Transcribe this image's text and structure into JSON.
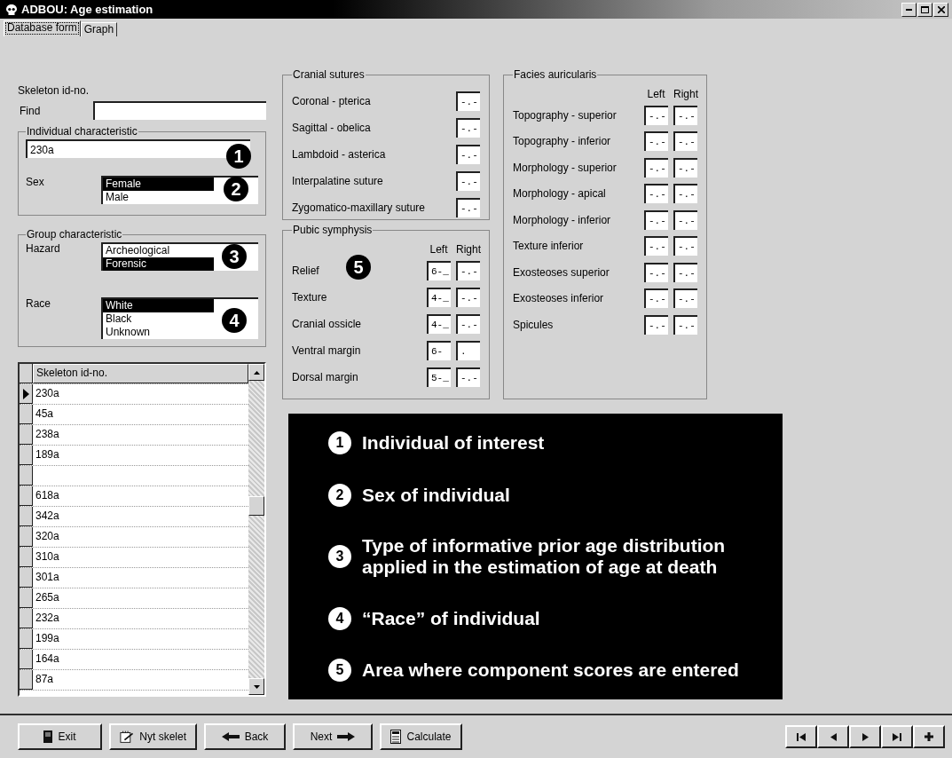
{
  "window": {
    "title": "ADBOU: Age estimation"
  },
  "tabs": [
    {
      "label": "Database form",
      "selected": true
    },
    {
      "label": "Graph",
      "selected": false
    }
  ],
  "skeleton_label": "Skeleton id-no.",
  "find": {
    "label": "Find"
  },
  "individual": {
    "title": "Individual characteristic",
    "id_value": "230a",
    "sex": {
      "label": "Sex",
      "options": [
        {
          "label": "Female",
          "selected": true
        },
        {
          "label": "Male",
          "selected": false
        }
      ]
    }
  },
  "group": {
    "title": "Group characteristic",
    "hazard": {
      "label": "Hazard",
      "options": [
        {
          "label": "Archeological",
          "selected": false
        },
        {
          "label": "Forensic",
          "selected": true
        }
      ]
    },
    "race": {
      "label": "Race",
      "options": [
        {
          "label": "White",
          "selected": true
        },
        {
          "label": "Black",
          "selected": false
        },
        {
          "label": "Unknown",
          "selected": false
        }
      ]
    }
  },
  "table": {
    "column": "Skeleton id-no.",
    "rows": [
      {
        "id": "230a",
        "selected": true
      },
      {
        "id": "45a",
        "selected": false
      },
      {
        "id": "238a",
        "selected": false
      },
      {
        "id": "189a",
        "selected": false
      },
      {
        "selected": false
      },
      {
        "id": "618a",
        "selected": false
      },
      {
        "id": "342a",
        "selected": false
      },
      {
        "id": "320a",
        "selected": false
      },
      {
        "id": "310a",
        "selected": false
      },
      {
        "id": "301a",
        "selected": false
      },
      {
        "id": "265a",
        "selected": false
      },
      {
        "id": "232a",
        "selected": false
      },
      {
        "id": "199a",
        "selected": false
      },
      {
        "id": "164a",
        "selected": false
      },
      {
        "id": "87a",
        "selected": false
      }
    ]
  },
  "cranial_sutures": {
    "title": "Cranial sutures",
    "rows": [
      {
        "label": "Coronal - pterica",
        "value": "-.-"
      },
      {
        "label": "Sagittal - obelica",
        "value": "-.-"
      },
      {
        "label": "Lambdoid - asterica",
        "value": "-.-"
      },
      {
        "label": "Interpalatine suture",
        "value": "-.-"
      },
      {
        "label": "Zygomatico-maxillary suture",
        "value": "-.-"
      }
    ]
  },
  "pubic_symphysis": {
    "title": "Pubic symphysis",
    "columns": [
      "Left",
      "Right"
    ],
    "rows": [
      {
        "label": "Relief",
        "left": "6-_",
        "right": "-.-"
      },
      {
        "label": "Texture",
        "left": "4-_",
        "right": "-.-"
      },
      {
        "label": "Cranial ossicle",
        "left": "4-_",
        "right": "-.-"
      },
      {
        "label": "Ventral margin",
        "left": "6-",
        "right": "."
      },
      {
        "label": "Dorsal margin",
        "left": "5-_",
        "right": "-.-"
      }
    ]
  },
  "facies_auricularis": {
    "title": "Facies auricularis",
    "columns": [
      "Left",
      "Right"
    ],
    "rows": [
      {
        "label": "Topography - superior",
        "left": "-.-",
        "right": "-.-"
      },
      {
        "label": "Topography - inferior",
        "left": "-.-",
        "right": "-.-"
      },
      {
        "label": "Morphology - superior",
        "left": "-.-",
        "right": "-.-"
      },
      {
        "label": "Morphology - apical",
        "left": "-.-",
        "right": "-.-"
      },
      {
        "label": "Morphology - inferior",
        "left": "-.-",
        "right": "-.-"
      },
      {
        "label": "Texture inferior",
        "left": "-.-",
        "right": "-.-"
      },
      {
        "label": "Exosteoses superior",
        "left": "-.-",
        "right": "-.-"
      },
      {
        "label": "Exosteoses inferior",
        "left": "-.-",
        "right": "-.-"
      },
      {
        "label": "Spicules",
        "left": "-.-",
        "right": "-.-"
      }
    ]
  },
  "badges": [
    "1",
    "2",
    "3",
    "4",
    "5"
  ],
  "legend": [
    {
      "number": "1",
      "text": "Individual of interest"
    },
    {
      "number": "2",
      "text": "Sex of individual"
    },
    {
      "number": "3",
      "text": "Type of informative prior age distribution applied in the estimation of age at death"
    },
    {
      "number": "4",
      "text": "“Race” of individual"
    },
    {
      "number": "5",
      "text": "Area where component scores are entered"
    }
  ],
  "buttons": [
    {
      "kind": "exit",
      "label": "Exit"
    },
    {
      "kind": "new",
      "label": "Nyt skelet"
    },
    {
      "kind": "back",
      "label": "Back"
    },
    {
      "kind": "next",
      "label": "Next"
    },
    {
      "kind": "calculate",
      "label": "Calculate"
    }
  ],
  "nav_buttons": [
    {
      "kind": "first"
    },
    {
      "kind": "prev"
    },
    {
      "kind": "next"
    },
    {
      "kind": "last"
    },
    {
      "kind": "add"
    }
  ]
}
